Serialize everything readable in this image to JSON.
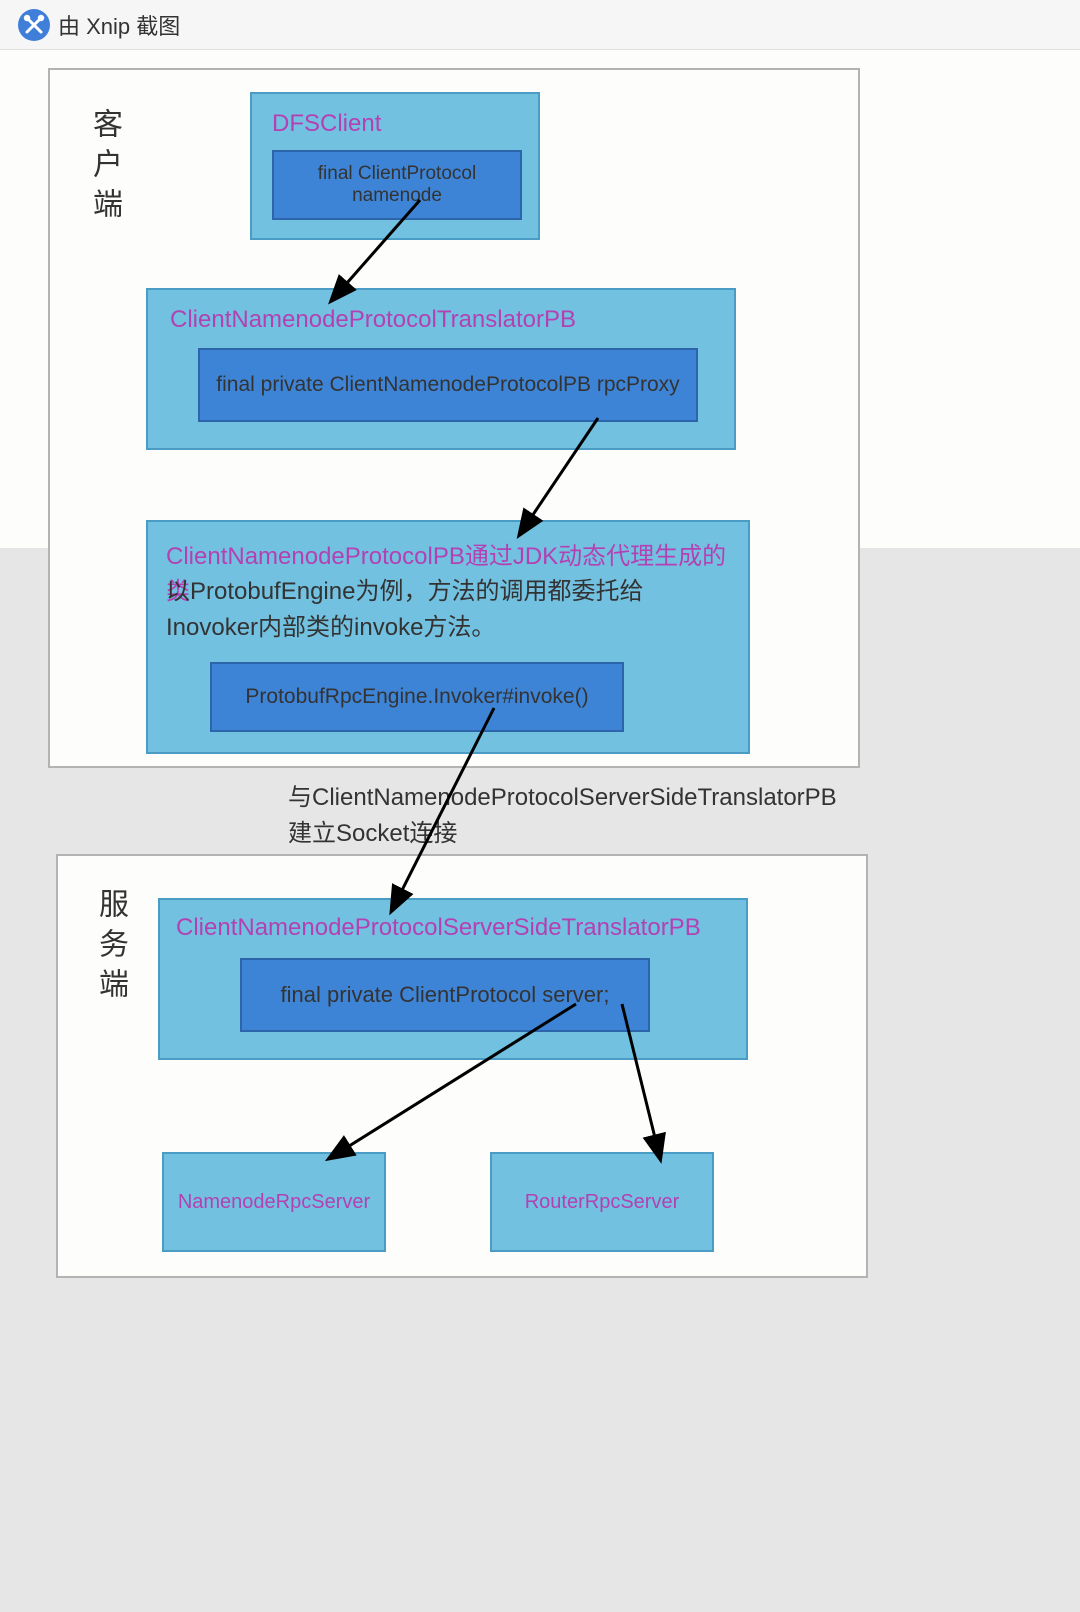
{
  "topbar": {
    "caption": "由 Xnip 截图"
  },
  "client": {
    "label": "客户端",
    "dfs": {
      "title": "DFSClient",
      "field": "final ClientProtocol namenode"
    },
    "translator": {
      "title": "ClientNamenodeProtocolTranslatorPB",
      "field": "final private ClientNamenodeProtocolPB rpcProxy"
    },
    "proxy": {
      "title": "ClientNamenodeProtocolPB通过JDK动态代理生成的类",
      "desc": "以ProtobufEngine为例，方法的调用都委托给Inovoker内部类的invoke方法。",
      "field": "ProtobufRpcEngine.Invoker#invoke()"
    }
  },
  "link_note": {
    "line1": "与ClientNamenodeProtocolServerSideTranslatorPB",
    "line2": "建立Socket连接"
  },
  "server": {
    "label": "服务端",
    "translator": {
      "title": "ClientNamenodeProtocolServerSideTranslatorPB",
      "field": "final private ClientProtocol server;"
    },
    "impl1": "NamenodeRpcServer",
    "impl2": "RouterRpcServer"
  }
}
